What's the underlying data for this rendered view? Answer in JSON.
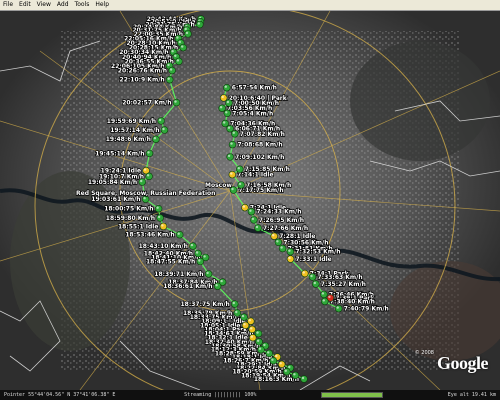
{
  "menu": [
    "File",
    "Edit",
    "View",
    "Add",
    "Tools",
    "Help"
  ],
  "place_labels": {
    "red_square": "Red Square, Moscow, Russian Federation",
    "moscow": "Moscow"
  },
  "track": [
    {
      "t": "20:43:44 Km/h",
      "type": "moving"
    },
    {
      "t": "20:51:0 | Idle",
      "type": "moving"
    },
    {
      "t": "20:31:75 Km/h",
      "type": "moving"
    },
    {
      "t": "20:24:84 Km/h",
      "type": "moving"
    },
    {
      "t": "20:31:75 Km/h",
      "type": "moving"
    },
    {
      "t": "22:00:35 Km/h",
      "type": "moving"
    },
    {
      "t": "22:05:16 Km/h",
      "type": "moving"
    },
    {
      "t": "20:28:10 Km/h",
      "type": "moving"
    },
    {
      "t": "20:28:15 Km/h",
      "type": "moving"
    },
    {
      "t": "20:30:34 Km/h",
      "type": "moving"
    },
    {
      "t": "20:40:94 Km/h",
      "type": "moving"
    },
    {
      "t": "20:36:55 Km/h",
      "type": "moving"
    },
    {
      "t": "22:06:105 Km/h",
      "type": "moving"
    },
    {
      "t": "20:26:76 Km/h",
      "type": "moving"
    },
    {
      "t": "6:57:54 Km/h",
      "type": "moving"
    },
    {
      "t": "22:10:9 Km/h",
      "type": "moving"
    },
    {
      "t": "20:10:6:40 | Park",
      "type": "parked"
    },
    {
      "t": "7:00:50 Km/h",
      "type": "moving"
    },
    {
      "t": "7:03:56 Km/h",
      "type": "moving"
    },
    {
      "t": "7:05:4 Km/h",
      "type": "moving"
    },
    {
      "t": "20:02:57 Km/h",
      "type": "moving"
    },
    {
      "t": "7:04:36 Km/h",
      "type": "moving"
    },
    {
      "t": "6:06:71 Km/h",
      "type": "moving"
    },
    {
      "t": "7:07:82 Km/h",
      "type": "moving"
    },
    {
      "t": "19:59:69 Km/h",
      "type": "moving"
    },
    {
      "t": "7:08:68 Km/h",
      "type": "moving"
    },
    {
      "t": "19:57:14 Km/h",
      "type": "moving"
    },
    {
      "t": "7:09:102 Km/h",
      "type": "moving"
    },
    {
      "t": "19:48:6 Km/h",
      "type": "moving"
    },
    {
      "t": "7:15:85 Km/h",
      "type": "moving"
    },
    {
      "t": "7:14:1 Idle",
      "type": "idle"
    },
    {
      "t": "19:45:14 Km/h",
      "type": "moving"
    },
    {
      "t": "7:16:58 Km/h",
      "type": "moving"
    },
    {
      "t": "7:17:75 Km/h",
      "type": "moving"
    },
    {
      "t": "19:24:1 Idle",
      "type": "idle"
    },
    {
      "t": "19:10:7 Km/h",
      "type": "moving"
    },
    {
      "t": "19:05:84 Km/h",
      "type": "moving"
    },
    {
      "t": "7:24:1 Idle",
      "type": "idle"
    },
    {
      "t": "7:24:33 Km/h",
      "type": "moving"
    },
    {
      "t": "19:03:61 Km/h",
      "type": "moving"
    },
    {
      "t": "7:26:95 Km/h",
      "type": "moving"
    },
    {
      "t": "18:00:75 Km/h",
      "type": "moving"
    },
    {
      "t": "7:27:66 Km/h",
      "type": "moving"
    },
    {
      "t": "18:59:80 Km/h",
      "type": "moving"
    },
    {
      "t": "7:28:1 Idle",
      "type": "idle"
    },
    {
      "t": "18:55:1 Idle",
      "type": "idle"
    },
    {
      "t": "7:30:56 Km/h",
      "type": "moving"
    },
    {
      "t": "18:53:46 Km/h",
      "type": "moving"
    },
    {
      "t": "7:31:81 Km/h",
      "type": "moving"
    },
    {
      "t": "7:32:53 Km/h",
      "type": "moving"
    },
    {
      "t": "18:43:10 Km/h",
      "type": "moving"
    },
    {
      "t": "7:33:1 Idle",
      "type": "idle"
    },
    {
      "t": "18:42:40 Km/h",
      "type": "moving"
    },
    {
      "t": "18:41:10 Km/h",
      "type": "moving"
    },
    {
      "t": "18:47:55 Km/h",
      "type": "moving"
    },
    {
      "t": "7:34:1 Park",
      "type": "parked"
    },
    {
      "t": "7:33:63 Km/h",
      "type": "moving"
    },
    {
      "t": "18:39:71 Km/h",
      "type": "moving"
    },
    {
      "t": "7:35:27 Km/h",
      "type": "moving"
    },
    {
      "t": "18:37:84 Km/h",
      "type": "moving"
    },
    {
      "t": "18:36:61 Km/h",
      "type": "moving"
    },
    {
      "t": "7:36:46 Km/h",
      "type": "moving"
    },
    {
      "t": "7:39:1 Park",
      "type": "stopped"
    },
    {
      "t": "7:38:40 Km/h",
      "type": "moving"
    },
    {
      "t": "18:37:75 Km/h",
      "type": "moving"
    },
    {
      "t": "7:40:79 Km/h",
      "type": "moving"
    },
    {
      "t": "18:35:79 Km/h",
      "type": "moving"
    },
    {
      "t": "18:33:75 Km/h",
      "type": "moving"
    },
    {
      "t": "18:09:1 | Idle",
      "type": "idle"
    },
    {
      "t": "18:05:1 Idle",
      "type": "idle"
    },
    {
      "t": "18:04:1 Park",
      "type": "parked"
    },
    {
      "t": "18:34:63 Km/h",
      "type": "moving"
    },
    {
      "t": "18:32:1 Idle",
      "type": "idle"
    },
    {
      "t": "18:32:40 Km/h",
      "type": "moving"
    },
    {
      "t": "18:30:58 Km/h",
      "type": "moving"
    },
    {
      "t": "18:12:3 Km/h",
      "type": "moving"
    },
    {
      "t": "18:28:59 Km/h",
      "type": "moving"
    },
    {
      "t": "18:18:1 Idle",
      "type": "idle"
    },
    {
      "t": "18:26:7 Km/h",
      "type": "moving"
    },
    {
      "t": "18:29:1 Idle",
      "type": "idle"
    },
    {
      "t": "18:22:84 Km/h",
      "type": "moving"
    },
    {
      "t": "18:20:59 Km/h",
      "type": "moving"
    },
    {
      "t": "18:19:54 Km/h",
      "type": "moving"
    },
    {
      "t": "18:16:3 Km/h",
      "type": "moving"
    }
  ],
  "marker_colors": {
    "moving": "#2fa83a",
    "idle": "#f0c020",
    "parked": "#f0c020",
    "stopped": "#d42a1e"
  },
  "logo": "Google",
  "copyright": "© 2008",
  "status": {
    "pointer": "Pointer 55°44'04.56\" N 37°41'06.38\" E",
    "streaming": "Streaming ||||||||| 100%",
    "streaming_level": 1.0,
    "eye_alt": "Eye alt 19.41 km"
  }
}
